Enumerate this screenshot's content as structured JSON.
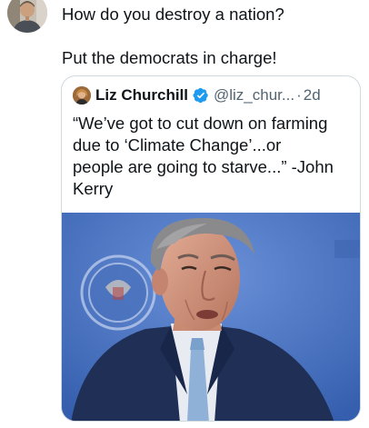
{
  "post": {
    "text_line_1": "How do you destroy a nation?",
    "text_line_2": "Put the democrats in charge!"
  },
  "quoted_post": {
    "author_name": "Liz Churchill",
    "handle": "@liz_chur...",
    "separator": "·",
    "time": "2d",
    "verified_color": "#1d9bf0",
    "text_lines": [
      "“We’ve got to cut down on farming",
      "due to ‘Climate Change’...or",
      "people are going to starve...” -John",
      "Kerry"
    ]
  },
  "colors": {
    "text": "#0f1419",
    "secondary_text": "#536471",
    "card_border": "#cfd9de",
    "image_background": "#4d76c4"
  }
}
